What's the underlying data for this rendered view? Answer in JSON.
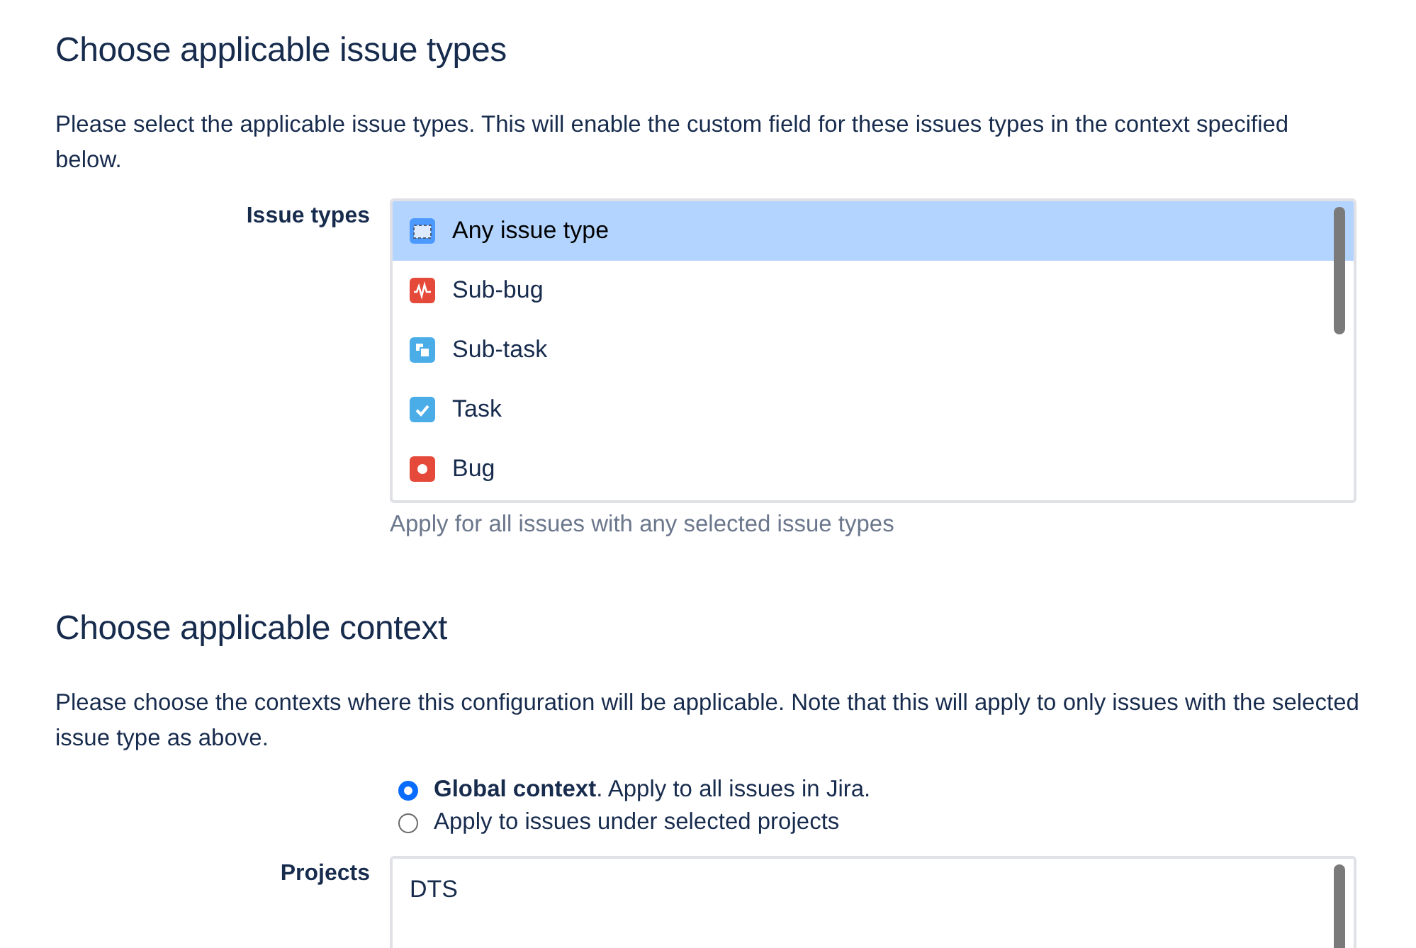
{
  "issue_types_section": {
    "heading": "Choose applicable issue types",
    "description": "Please select the applicable issue types. This will enable the custom field for these issues types in the context specified below.",
    "label": "Issue types",
    "options": [
      {
        "kind": "any",
        "label": "Any issue type",
        "selected": true
      },
      {
        "kind": "subbug",
        "label": "Sub-bug",
        "selected": false
      },
      {
        "kind": "subtask",
        "label": "Sub-task",
        "selected": false
      },
      {
        "kind": "task",
        "label": "Task",
        "selected": false
      },
      {
        "kind": "bug",
        "label": "Bug",
        "selected": false
      }
    ],
    "help": "Apply for all issues with any selected issue types"
  },
  "context_section": {
    "heading": "Choose applicable context",
    "description": "Please choose the contexts where this configuration will be applicable. Note that this will apply to only issues with the selected issue type as above.",
    "radios": [
      {
        "label": "**Global context**. Apply to all issues in Jira.",
        "selected": true
      },
      {
        "label": "Apply to issues under selected projects",
        "selected": false
      }
    ],
    "projects_label": "Projects",
    "projects": [
      {
        "label": "DTS",
        "selected": false
      }
    ]
  }
}
